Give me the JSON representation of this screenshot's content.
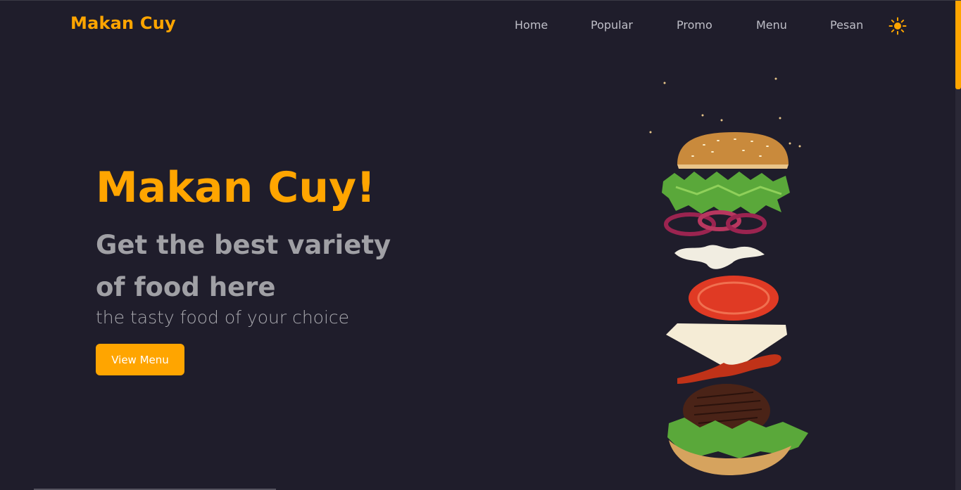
{
  "header": {
    "brand": "Makan Cuy",
    "nav": [
      {
        "label": "Home"
      },
      {
        "label": "Popular"
      },
      {
        "label": "Promo"
      },
      {
        "label": "Menu"
      },
      {
        "label": "Pesan"
      }
    ],
    "theme_icon": "sun-icon"
  },
  "hero": {
    "title": "Makan Cuy!",
    "subtitle": "Get the best variety of food here",
    "tagline": "the tasty food of your choice",
    "cta_label": "View Menu",
    "image": "burger-illustration"
  },
  "colors": {
    "background": "#1f1d2b",
    "accent": "#ffa500",
    "muted_text": "#a0a0a5"
  }
}
